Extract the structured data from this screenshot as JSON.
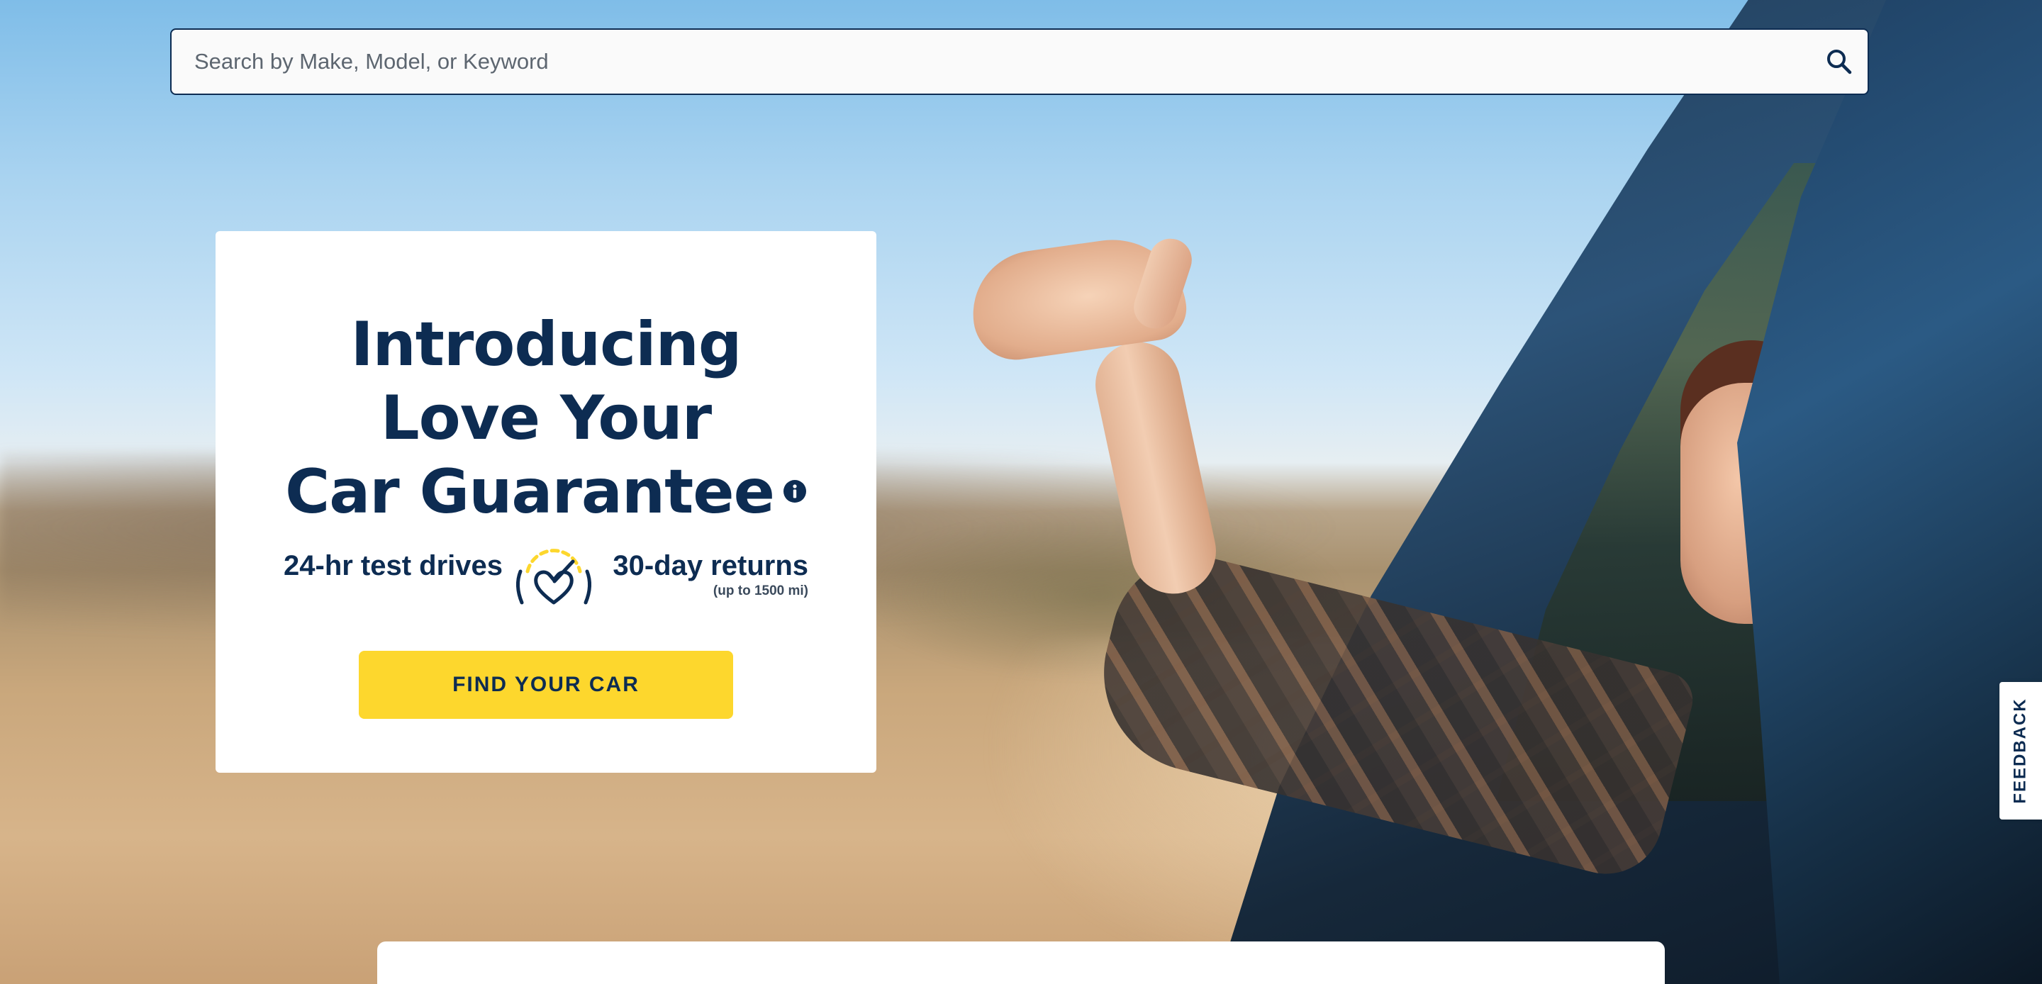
{
  "search": {
    "placeholder": "Search by Make, Model, or Keyword",
    "value": "",
    "icon": "search-icon"
  },
  "promo": {
    "headline_lines": [
      "Introducing",
      "Love Your",
      "Car Guarantee"
    ],
    "info_icon": "info-icon",
    "features": {
      "left": "24-hr test drives",
      "right": "30-day returns",
      "right_note": "(up to 1500 mi)",
      "center_icon": "heart-speedometer-icon"
    },
    "cta_label": "FIND YOUR CAR"
  },
  "feedback": {
    "label": "FEEDBACK"
  },
  "colors": {
    "navy": "#0d2c52",
    "yellow": "#fdd72d",
    "white": "#ffffff"
  }
}
